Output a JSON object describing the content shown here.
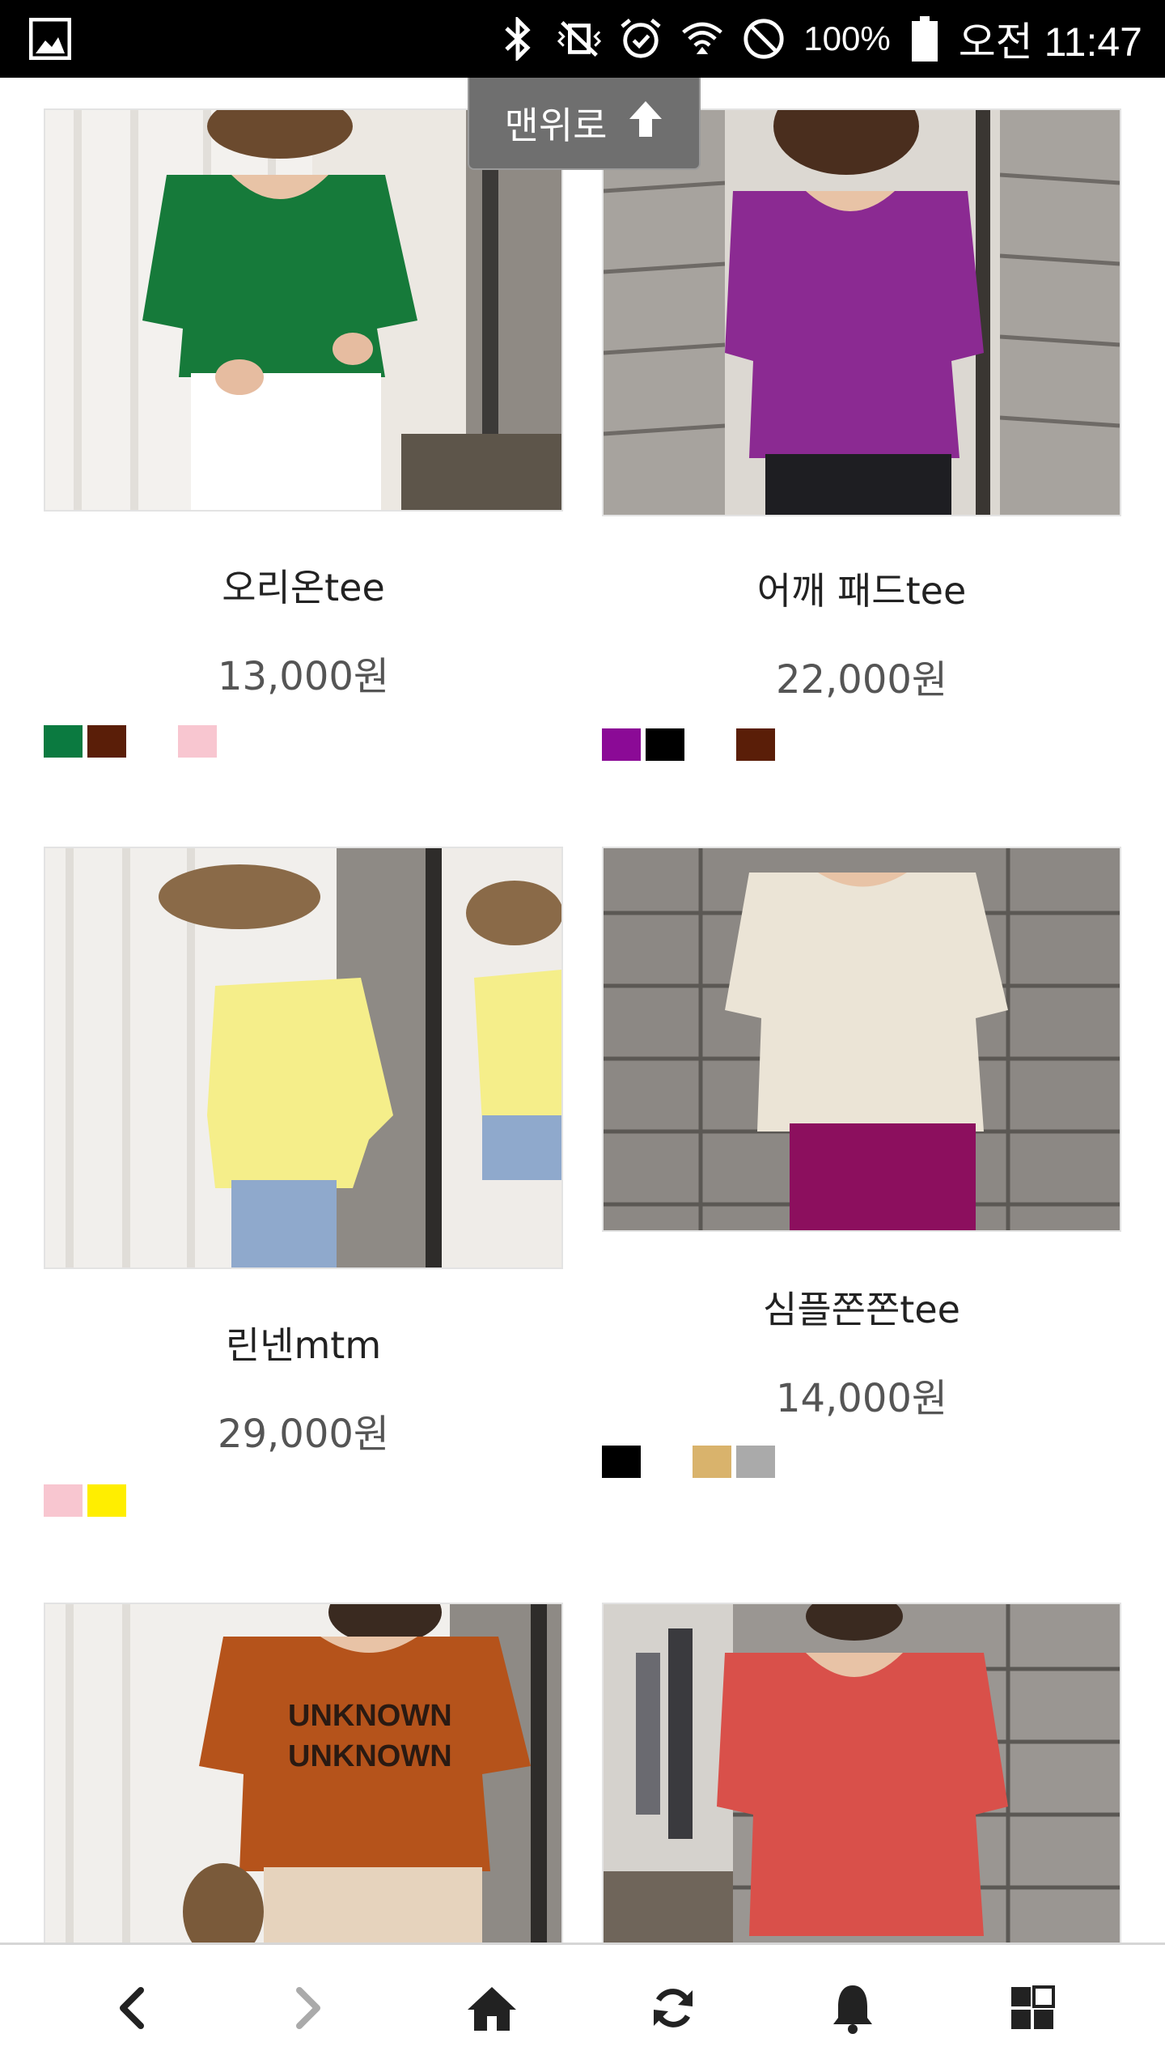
{
  "status_bar": {
    "battery": "100%",
    "time": "오전 11:47"
  },
  "top_button": {
    "label": "맨위로"
  },
  "products": [
    {
      "name": "오리온tee",
      "price": "13,000원",
      "swatches": [
        "#0b7a40",
        "#5a1e08",
        "#f8c6d0"
      ]
    },
    {
      "name": "어깨 패드tee",
      "price": "22,000원",
      "swatches": [
        "#8b0a96",
        "#000000",
        "#5a1e08"
      ]
    },
    {
      "name": "린넨mtm",
      "price": "29,000원",
      "swatches": [
        "#f8c6d0",
        "#ffee00"
      ]
    },
    {
      "name": "심플쫀쫀tee",
      "price": "14,000원",
      "swatches": [
        "#000000",
        "#d9b36c",
        "#aaaaaa"
      ]
    }
  ],
  "bottom_nav": [
    "back-icon",
    "forward-icon",
    "home-icon",
    "refresh-icon",
    "bell-icon",
    "menu-grid-icon"
  ]
}
